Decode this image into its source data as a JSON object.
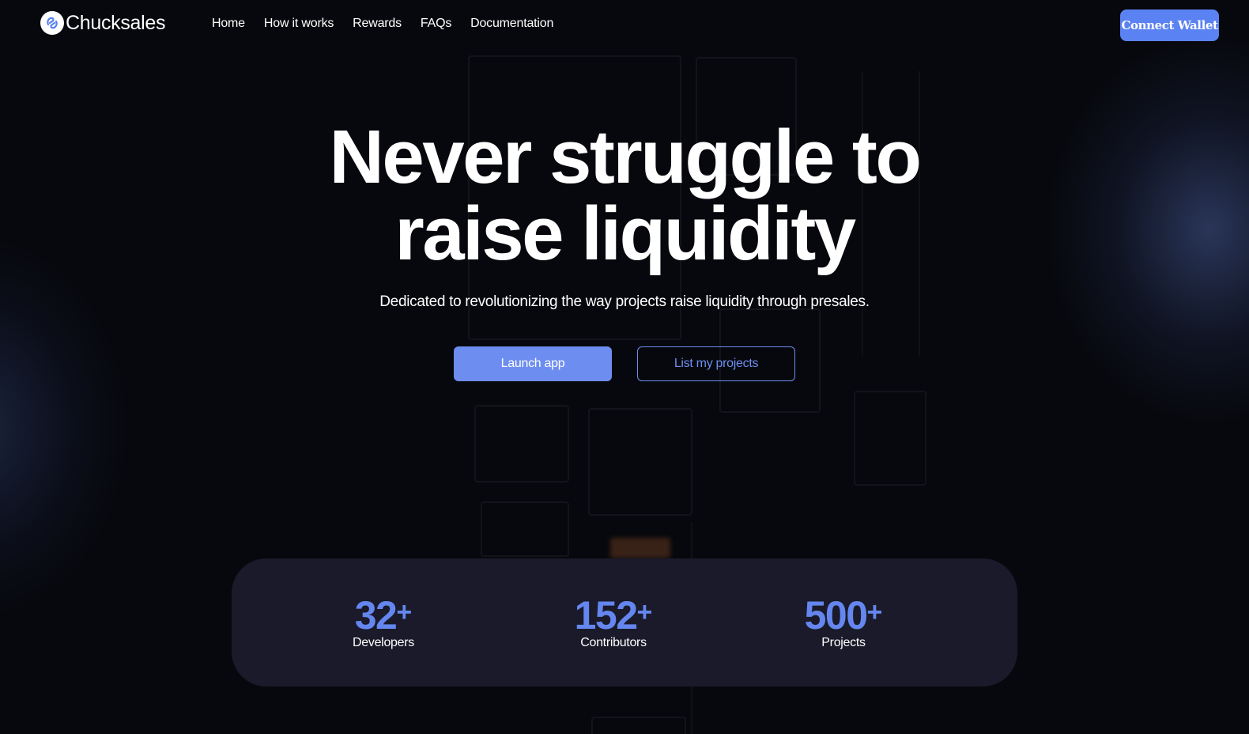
{
  "brand": {
    "name": "Chucksales",
    "logo_icon": "chucksales-logo-icon",
    "accent_color": "#5b82f2"
  },
  "nav": {
    "items": [
      {
        "label": "Home"
      },
      {
        "label": "How it works"
      },
      {
        "label": "Rewards"
      },
      {
        "label": "FAQs"
      },
      {
        "label": "Documentation"
      }
    ]
  },
  "header": {
    "connect_label": "Connect Wallet"
  },
  "hero": {
    "title_line1": "Never struggle to",
    "title_line2": "raise liquidity",
    "subtitle": "Dedicated to revolutionizing the way projects raise liquidity through presales.",
    "primary_cta": "Launch app",
    "secondary_cta": "List my projects"
  },
  "stats": [
    {
      "value": "32",
      "suffix": "+",
      "label": "Developers"
    },
    {
      "value": "152",
      "suffix": "+",
      "label": "Contributors"
    },
    {
      "value": "500",
      "suffix": "+",
      "label": "Projects"
    }
  ]
}
